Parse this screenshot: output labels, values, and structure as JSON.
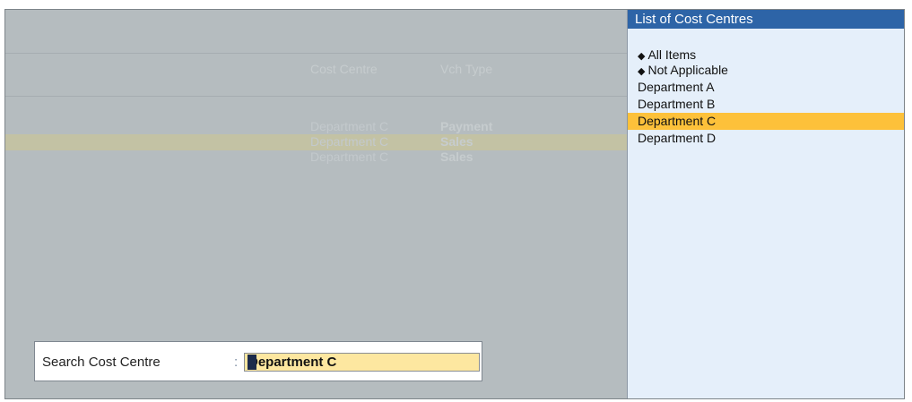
{
  "report": {
    "columns": [
      "Cost Centre",
      "Vch Type"
    ],
    "rows": [
      {
        "cost_centre": "Department C",
        "vch_type": "Payment"
      },
      {
        "cost_centre": "Department C",
        "vch_type": "Sales"
      },
      {
        "cost_centre": "Department C",
        "vch_type": "Sales"
      }
    ]
  },
  "search": {
    "label": "Search Cost Centre",
    "separator": ":",
    "value": "Department C"
  },
  "list": {
    "title": "List of Cost Centres",
    "bullet_glyph": "◆",
    "items": [
      {
        "label": "All Items",
        "bullet": true
      },
      {
        "label": "Not Applicable",
        "bullet": true
      },
      {
        "label": "Department A",
        "bullet": false
      },
      {
        "label": "Department B",
        "bullet": false
      },
      {
        "label": "Department C",
        "bullet": false,
        "selected": true
      },
      {
        "label": "Department D",
        "bullet": false
      }
    ]
  },
  "colors": {
    "list_header": "#2d64a7",
    "selection": "#fdc13a",
    "input_background": "#fde7a0",
    "background_pane": "#b5bcbf"
  }
}
